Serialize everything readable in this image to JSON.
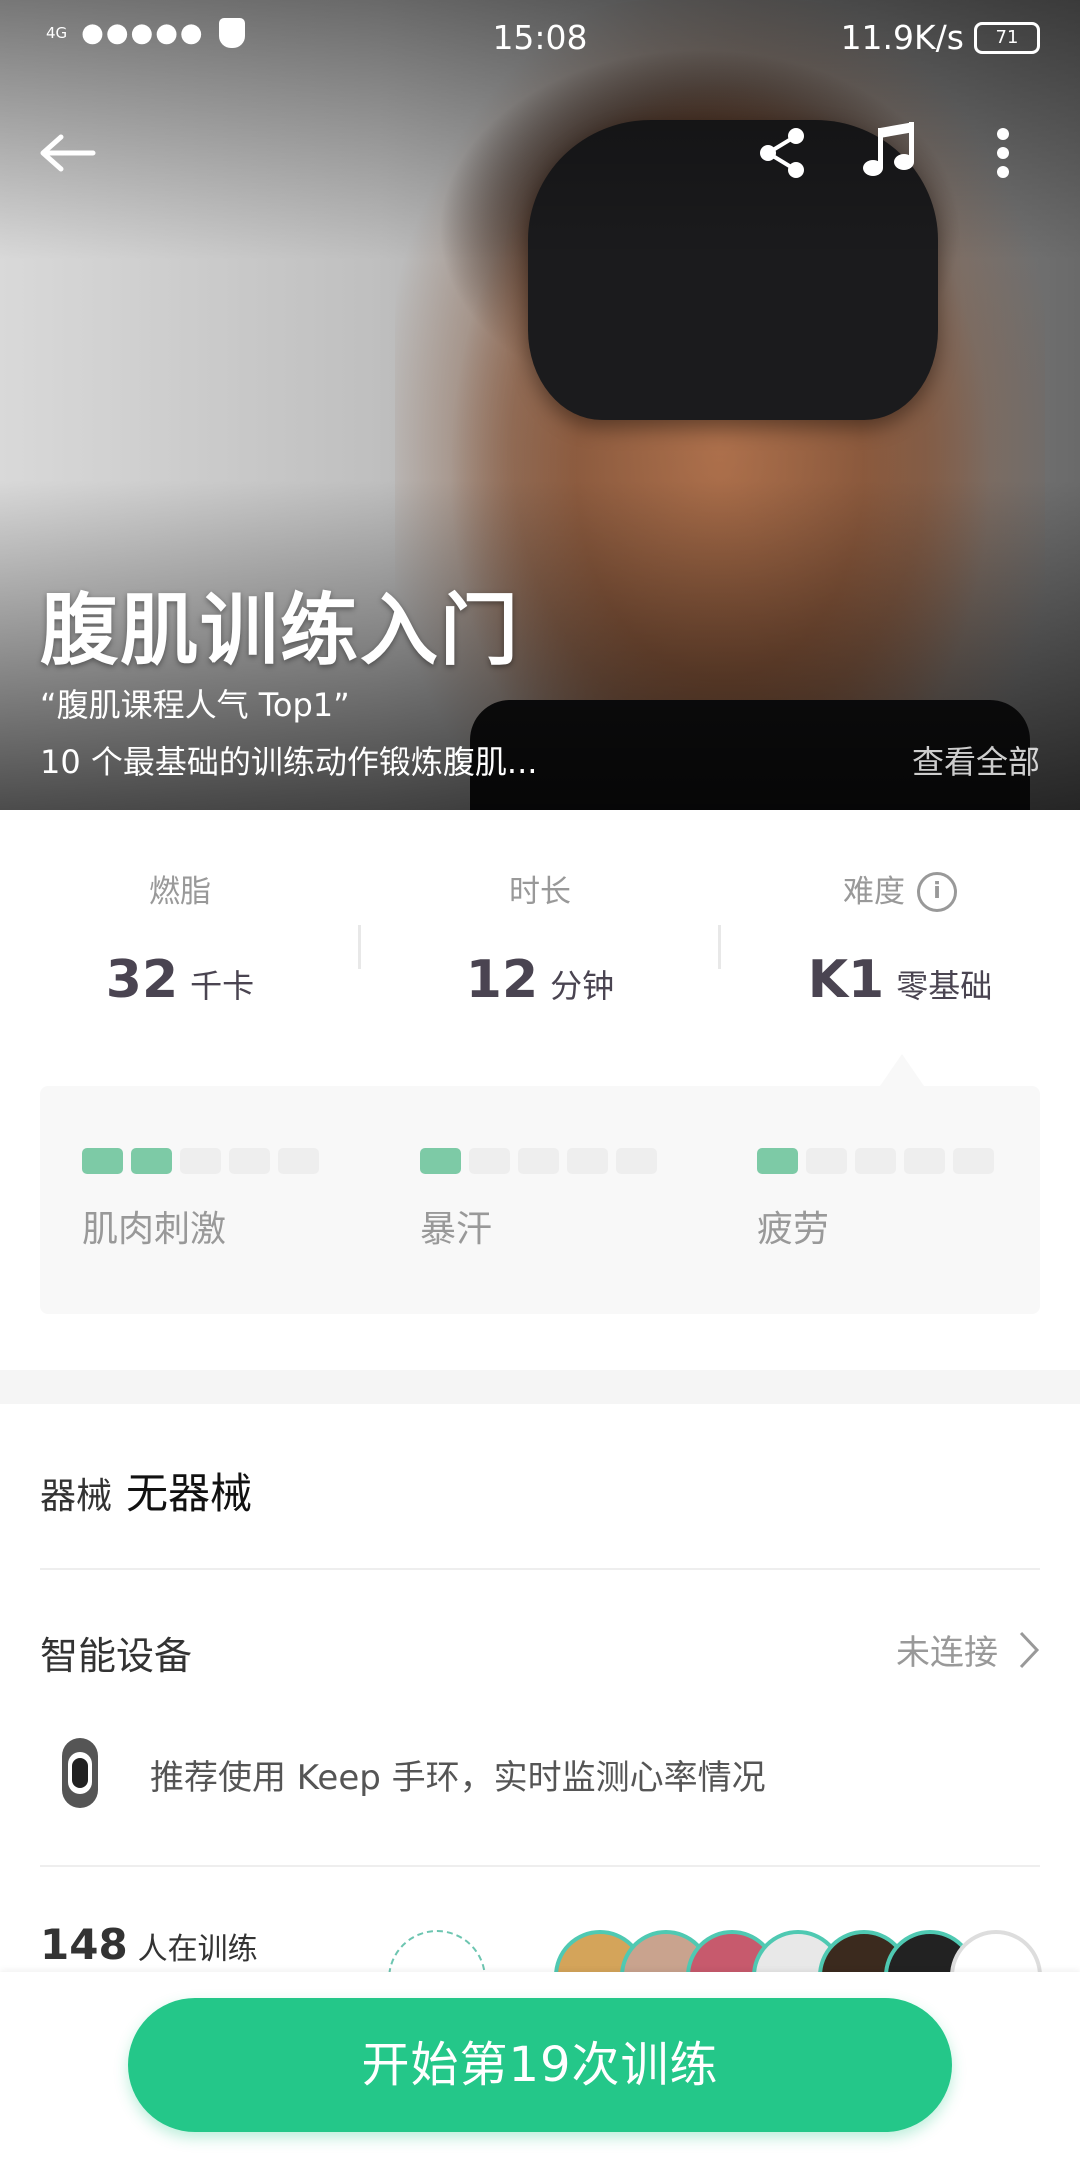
{
  "status_bar": {
    "network": "4G",
    "signal": "●●●●●",
    "time": "15:08",
    "speed": "11.9K/s",
    "battery": "71"
  },
  "toolbar": {
    "back_icon": "back-arrow-icon",
    "share_icon": "share-icon",
    "music_icon": "music-note-icon",
    "more_icon": "more-vertical-icon"
  },
  "hero": {
    "title": "腹肌训练入门",
    "quote": "“腹肌课程人气 Top1”",
    "description": "10 个最基础的训练动作锻炼腹肌...",
    "view_all": "查看全部"
  },
  "stats": [
    {
      "label": "燃脂",
      "value": "32",
      "unit": "千卡"
    },
    {
      "label": "时长",
      "value": "12",
      "unit": "分钟"
    },
    {
      "label": "难度",
      "value": "K1",
      "unit": "零基础"
    }
  ],
  "intensity": [
    {
      "label": "肌肉刺激",
      "level": 2,
      "max": 5
    },
    {
      "label": "暴汗",
      "level": 1,
      "max": 5
    },
    {
      "label": "疲劳",
      "level": 1,
      "max": 5
    }
  ],
  "equipment": {
    "label": "器械",
    "value": "无器械"
  },
  "smart_device": {
    "label": "智能设备",
    "status": "未连接",
    "recommend": "推荐使用 Keep 手环，实时监测心率情况"
  },
  "training": {
    "count": "148",
    "label": "人在训练"
  },
  "start_button": "开始第19次训练",
  "colors": {
    "accent": "#24c789",
    "meter_on": "#7dcaa6",
    "meter_off": "#eeeeee"
  }
}
